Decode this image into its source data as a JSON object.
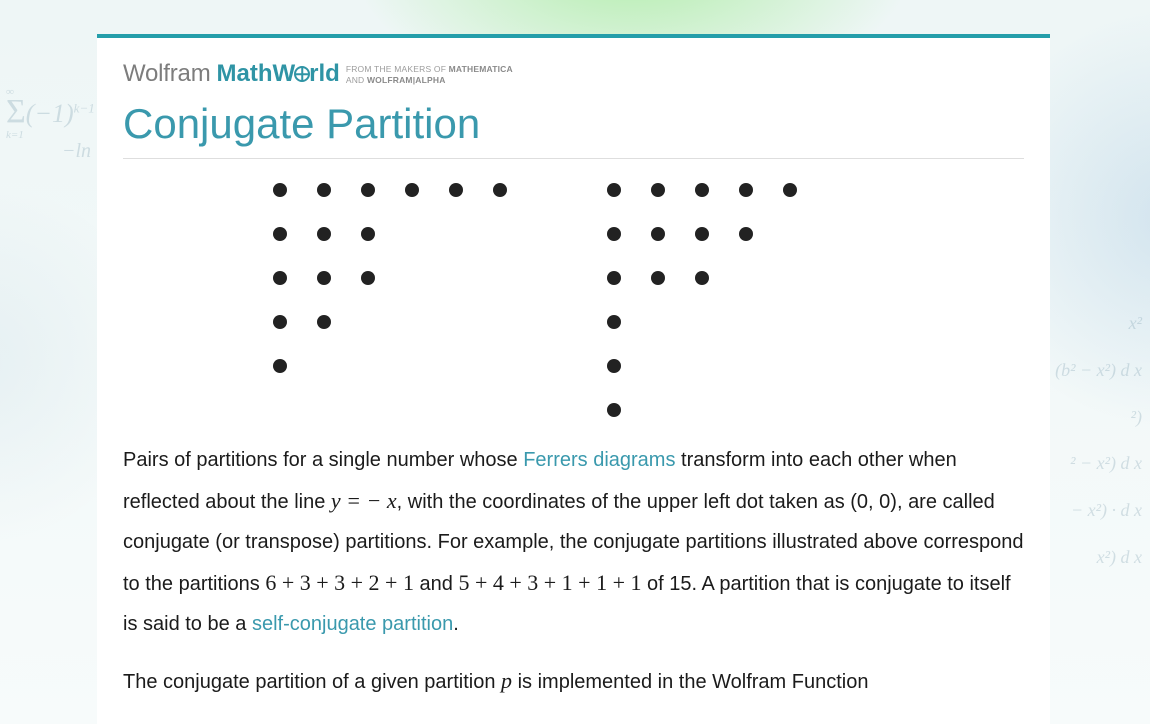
{
  "bg": {
    "leftSum": {
      "top": "∞",
      "body": "(−1)",
      "exp": "k−1",
      "bottom": "k=1"
    },
    "leftLn": "−ln",
    "right": [
      "x²",
      "(b² − x²) d x",
      "²)",
      "² − x²) d x",
      "− x²) · d x",
      "x²) d x"
    ]
  },
  "header": {
    "wolfram": "Wolfram",
    "math": "MathW",
    "rld": "rld",
    "tag1a": "FROM THE MAKERS OF ",
    "tag1b": "MATHEMATICA",
    "tag2a": "AND ",
    "tag2b": "WOLFRAM|ALPHA"
  },
  "title": "Conjugate Partition",
  "ferrers": {
    "left": [
      6,
      3,
      3,
      2,
      1
    ],
    "right": [
      5,
      4,
      3,
      1,
      1,
      1
    ]
  },
  "para1": {
    "t1": "Pairs of partitions for a single number whose ",
    "link1": "Ferrers diagrams",
    "t2": " transform into each other when reflected about the line ",
    "m1": "y = − x",
    "t3": ", with the coordinates of the upper left dot taken as (0, 0), are called conjugate (or transpose) partitions. For example, the conjugate partitions illustrated above correspond to the partitions ",
    "m2": "6 + 3 + 3 + 2 + 1",
    "t4": " and ",
    "m3": "5 + 4 + 3 + 1 + 1 + 1",
    "t5": " of 15. A partition that is conjugate to itself is said to be a ",
    "link2": "self-conjugate partition",
    "t6": "."
  },
  "para2": {
    "t1": "The conjugate partition of a given partition ",
    "m1": "p",
    "t2": " is implemented in the Wolfram Function"
  }
}
